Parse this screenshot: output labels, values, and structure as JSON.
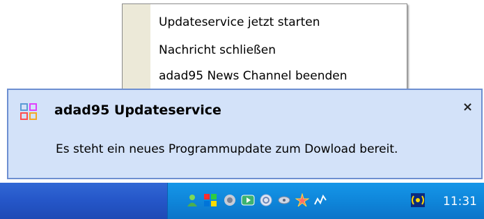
{
  "context_menu": {
    "items": [
      {
        "label": "Updateservice jetzt starten"
      },
      {
        "label": "Nachricht schließen"
      },
      {
        "label": "adad95 News Channel beenden"
      }
    ]
  },
  "balloon": {
    "title": "adad95 Updateservice",
    "message": "Es steht ein neues Programmupdate zum Dowload bereit.",
    "close_symbol": "×",
    "icon": "app-grid-icon"
  },
  "taskbar": {
    "clock": "11:31",
    "tray_icons": [
      "user-icon",
      "flag-icon",
      "speaker-icon",
      "media-icon",
      "sync-icon",
      "network-icon",
      "star-icon",
      "chart-icon",
      "wireless-icon"
    ]
  }
}
